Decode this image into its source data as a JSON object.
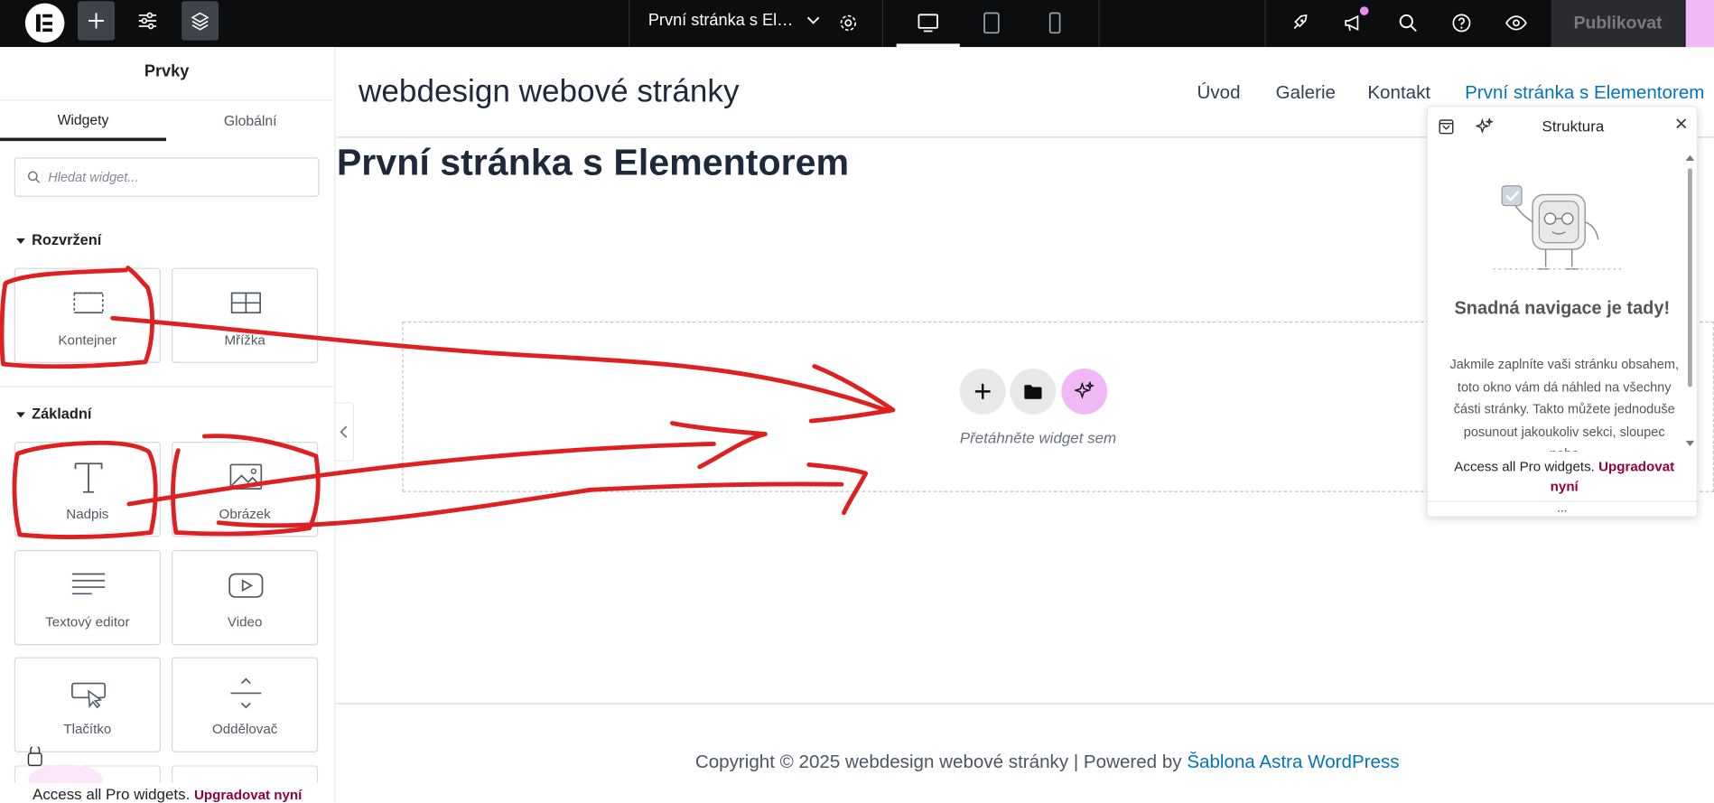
{
  "topbar": {
    "page_name": "První stránka s El…",
    "publish_label": "Publikovat",
    "icons": [
      "elementor-logo-icon",
      "add-icon",
      "settings-sliders-icon",
      "layers-icon",
      "page-settings-gear-icon",
      "desktop-icon",
      "tablet-icon",
      "mobile-icon",
      "rocket-icon",
      "megaphone-icon",
      "search-icon",
      "help-icon",
      "preview-eye-icon"
    ]
  },
  "panel": {
    "title": "Prvky",
    "tabs": [
      "Widgety",
      "Globální"
    ],
    "search_placeholder": "Hledat widget...",
    "sections": {
      "layout": "Rozvržení",
      "basic": "Základní"
    },
    "widgets": {
      "container": "Kontejner",
      "grid": "Mřížka",
      "heading": "Nadpis",
      "image": "Obrázek",
      "text_editor": "Textový editor",
      "video": "Video",
      "button": "Tlačítko",
      "divider": "Oddělovač"
    },
    "pro_text": "Access all Pro widgets.",
    "pro_link": "Upgradovat nyní"
  },
  "site": {
    "title": "webdesign webové stránky",
    "nav": [
      "Úvod",
      "Galerie",
      "Kontakt",
      "První stránka s Elementorem"
    ],
    "page_heading": "První stránka s Elementorem",
    "drop_text": "Přetáhněte widget sem",
    "footer_text": "Copyright © 2025 webdesign webové stránky | Powered by",
    "footer_link": "Šablona Astra WordPress"
  },
  "structure": {
    "title": "Struktura",
    "heading": "Snadná navigace je tady!",
    "body": "Jakmile zaplníte vaši stránku obsahem, toto okno vám dá náhled na všechny části stránky. Takto můžete jednoduše posunout jakoukoliv sekci, sloupec nebo",
    "pro_text": "Access all Pro widgets.",
    "pro_link": "Upgradovat nyní",
    "more": "..."
  },
  "colors": {
    "topbar": "#0c0d0e",
    "accent_pink": "#f0b8f5",
    "link_blue": "#0274be",
    "pro_magenta": "#93003f",
    "annotation_red": "#e02020"
  }
}
